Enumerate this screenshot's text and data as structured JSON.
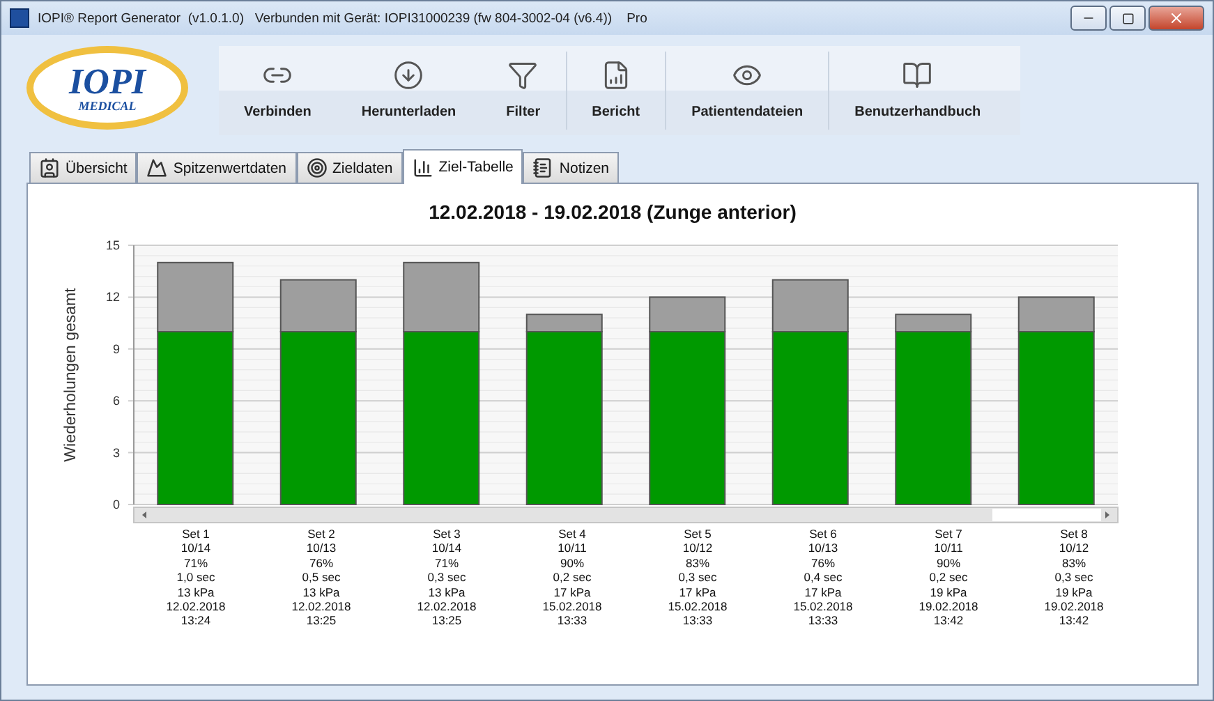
{
  "window": {
    "title": "IOPI® Report Generator  (v1.0.1.0)   Verbunden mit Gerät: IOPI31000239 (fw 804-3002-04 (v6.4))    Pro"
  },
  "logo": {
    "text": "IOPI",
    "subtext": "MEDICAL"
  },
  "toolbar": [
    {
      "label": "Verbinden",
      "kind": "link"
    },
    {
      "label": "Herunterladen",
      "kind": "download"
    },
    {
      "label": "Filter",
      "kind": "filter"
    },
    {
      "label": "Bericht",
      "kind": "report"
    },
    {
      "label": "Patientendateien",
      "kind": "patient"
    },
    {
      "label": "Benutzerhandbuch",
      "kind": "manual"
    }
  ],
  "tabs": [
    {
      "label": "Übersicht",
      "kind": "overview",
      "selected": false
    },
    {
      "label": "Spitzenwertdaten",
      "kind": "peak",
      "selected": false
    },
    {
      "label": "Zieldaten",
      "kind": "target",
      "selected": false
    },
    {
      "label": "Ziel-Tabelle",
      "kind": "bars",
      "selected": true
    },
    {
      "label": "Notizen",
      "kind": "notes",
      "selected": false
    }
  ],
  "chart_data": {
    "type": "bar",
    "stacked": true,
    "grid": true,
    "title": "12.02.2018 - 19.02.2018 (Zunge anterior)",
    "ylabel": "Wiederholungen gesamt",
    "ylim": [
      0,
      15
    ],
    "yticks": [
      0,
      3,
      6,
      9,
      12,
      15
    ],
    "categories": [
      "Set 1\n10/14\n71%\n1,0 sec\n13 kPa\n12.02.2018\n13:24",
      "Set 2\n10/13\n76%\n0,5 sec\n13 kPa\n12.02.2018\n13:25",
      "Set 3\n10/14\n71%\n0,3 sec\n13 kPa\n12.02.2018\n13:25",
      "Set 4\n10/11\n90%\n0,2 sec\n17 kPa\n15.02.2018\n13:33",
      "Set 5\n10/12\n83%\n0,3 sec\n17 kPa\n15.02.2018\n13:33",
      "Set 6\n10/13\n76%\n0,4 sec\n17 kPa\n15.02.2018\n13:33",
      "Set 7\n10/11\n90%\n0,2 sec\n19 kPa\n19.02.2018\n13:42",
      "Set 8\n10/12\n83%\n0,3 sec\n19 kPa\n19.02.2018\n13:42"
    ],
    "series": [
      {
        "color": "#009900",
        "values": [
          10,
          10,
          10,
          10,
          10,
          10,
          10,
          10
        ]
      },
      {
        "color": "#9e9e9e",
        "values": [
          4,
          3,
          4,
          1,
          2,
          3,
          1,
          2
        ]
      }
    ]
  }
}
